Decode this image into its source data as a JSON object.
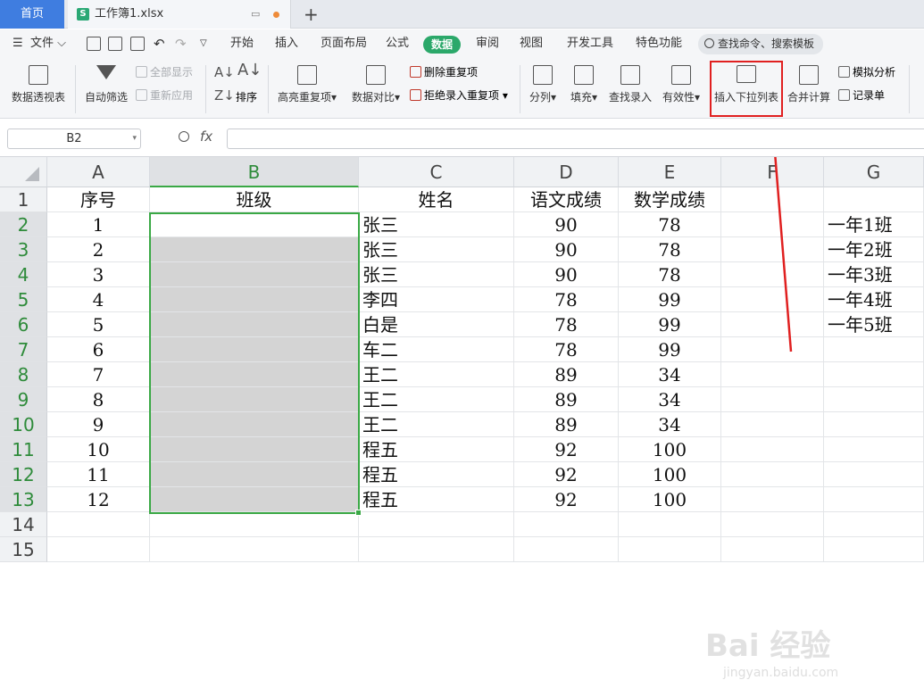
{
  "tabs": {
    "home": "首页",
    "file_name": "工作簿1.xlsx",
    "file_icon": "S",
    "new_tab": "+"
  },
  "menu": {
    "file": "文件",
    "items": [
      "开始",
      "插入",
      "页面布局",
      "公式",
      "数据",
      "审阅",
      "视图",
      "开发工具",
      "特色功能"
    ],
    "active": "数据",
    "search_placeholder": "查找命令、搜索模板"
  },
  "ribbon": {
    "pivot": "数据透视表",
    "autofilter": "自动筛选",
    "show_all": "全部显示",
    "reapply": "重新应用",
    "sort": "排序",
    "highlight_dup": "高亮重复项",
    "compare": "数据对比",
    "remove_dup": "删除重复项",
    "reject_dup": "拒绝录入重复项",
    "split": "分列",
    "fill": "填充",
    "lookup": "查找录入",
    "validity": "有效性",
    "insert_dropdown": "插入下拉列表",
    "consolidate": "合并计算",
    "simulate": "模拟分析",
    "record": "记录单"
  },
  "formula_bar": {
    "name_box": "B2",
    "fx": "fx",
    "value": ""
  },
  "grid": {
    "columns": [
      "A",
      "B",
      "C",
      "D",
      "E",
      "F",
      "G"
    ],
    "selected_column": "B",
    "rows": [
      "1",
      "2",
      "3",
      "4",
      "5",
      "6",
      "7",
      "8",
      "9",
      "10",
      "11",
      "12",
      "13",
      "14",
      "15"
    ],
    "headers": {
      "A": "序号",
      "B": "班级",
      "C": "姓名",
      "D": "语文成绩",
      "E": "数学成绩"
    },
    "data": [
      {
        "A": "1",
        "C": "张三",
        "D": "90",
        "E": "78",
        "G": "一年1班"
      },
      {
        "A": "2",
        "C": "张三",
        "D": "90",
        "E": "78",
        "G": "一年2班"
      },
      {
        "A": "3",
        "C": "张三",
        "D": "90",
        "E": "78",
        "G": "一年3班"
      },
      {
        "A": "4",
        "C": "李四",
        "D": "78",
        "E": "99",
        "G": "一年4班"
      },
      {
        "A": "5",
        "C": "白是",
        "D": "78",
        "E": "99",
        "G": "一年5班"
      },
      {
        "A": "6",
        "C": "车二",
        "D": "78",
        "E": "99",
        "G": ""
      },
      {
        "A": "7",
        "C": "王二",
        "D": "89",
        "E": "34",
        "G": ""
      },
      {
        "A": "8",
        "C": "王二",
        "D": "89",
        "E": "34",
        "G": ""
      },
      {
        "A": "9",
        "C": "王二",
        "D": "89",
        "E": "34",
        "G": ""
      },
      {
        "A": "10",
        "C": "程五",
        "D": "92",
        "E": "100",
        "G": ""
      },
      {
        "A": "11",
        "C": "程五",
        "D": "92",
        "E": "100",
        "G": ""
      },
      {
        "A": "12",
        "C": "程五",
        "D": "92",
        "E": "100",
        "G": ""
      }
    ]
  },
  "watermark": {
    "main": "Bai 经验",
    "sub": "jingyan.baidu.com"
  },
  "colors": {
    "accent": "#2ba86a",
    "home_tab": "#3f7de0",
    "annotation": "#e02020"
  }
}
